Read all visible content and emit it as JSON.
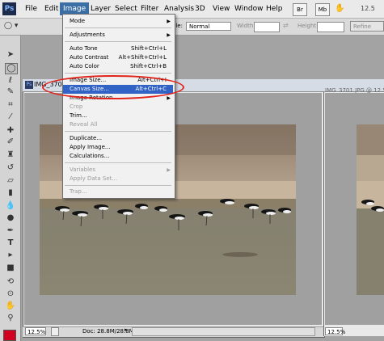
{
  "menubar": {
    "logo": "Ps",
    "menus": [
      "File",
      "Edit",
      "Image",
      "Layer",
      "Select",
      "Filter",
      "Analysis",
      "3D",
      "View",
      "Window",
      "Help"
    ],
    "bridge_label": "Br",
    "minibridge_label": "Mb",
    "zoom_readout": "12.5"
  },
  "options": {
    "style_label": "Style:",
    "style_value": "Normal",
    "width_label": "Width:",
    "height_label": "Height:",
    "refine_edge": "Refine Edge..."
  },
  "image_menu": {
    "items": [
      {
        "label": "Mode",
        "shortcut": "",
        "submenu": true,
        "disabled": false
      },
      {
        "label": "Adjustments",
        "shortcut": "",
        "submenu": true,
        "disabled": false
      },
      {
        "label": "Auto Tone",
        "shortcut": "Shift+Ctrl+L",
        "submenu": false,
        "disabled": false
      },
      {
        "label": "Auto Contrast",
        "shortcut": "Alt+Shift+Ctrl+L",
        "submenu": false,
        "disabled": false
      },
      {
        "label": "Auto Color",
        "shortcut": "Shift+Ctrl+B",
        "submenu": false,
        "disabled": false
      },
      {
        "label": "Image Size...",
        "shortcut": "Alt+Ctrl+I",
        "submenu": false,
        "disabled": false
      },
      {
        "label": "Canvas Size...",
        "shortcut": "Alt+Ctrl+C",
        "submenu": false,
        "disabled": false,
        "highlighted": true
      },
      {
        "label": "Image Rotation",
        "shortcut": "",
        "submenu": true,
        "disabled": false
      },
      {
        "label": "Crop",
        "shortcut": "",
        "submenu": false,
        "disabled": true
      },
      {
        "label": "Trim...",
        "shortcut": "",
        "submenu": false,
        "disabled": false
      },
      {
        "label": "Reveal All",
        "shortcut": "",
        "submenu": false,
        "disabled": true
      },
      {
        "label": "Duplicate...",
        "shortcut": "",
        "submenu": false,
        "disabled": false
      },
      {
        "label": "Apply Image...",
        "shortcut": "",
        "submenu": false,
        "disabled": false
      },
      {
        "label": "Calculations...",
        "shortcut": "",
        "submenu": false,
        "disabled": false
      },
      {
        "label": "Variables",
        "shortcut": "",
        "submenu": true,
        "disabled": true
      },
      {
        "label": "Apply Data Set...",
        "shortcut": "",
        "submenu": false,
        "disabled": true
      },
      {
        "label": "Trap...",
        "shortcut": "",
        "submenu": false,
        "disabled": true
      }
    ]
  },
  "document": {
    "title": "IMG_370",
    "zoom": "12.5%",
    "info": "Doc: 28.8M/28.8M"
  },
  "document2": {
    "title": "IMG_3701.JPG @ 12.5",
    "zoom": "12.5%"
  },
  "colors": {
    "highlight": "#3162c5",
    "annotation": "#e0241c",
    "foreground": "#d10020"
  }
}
